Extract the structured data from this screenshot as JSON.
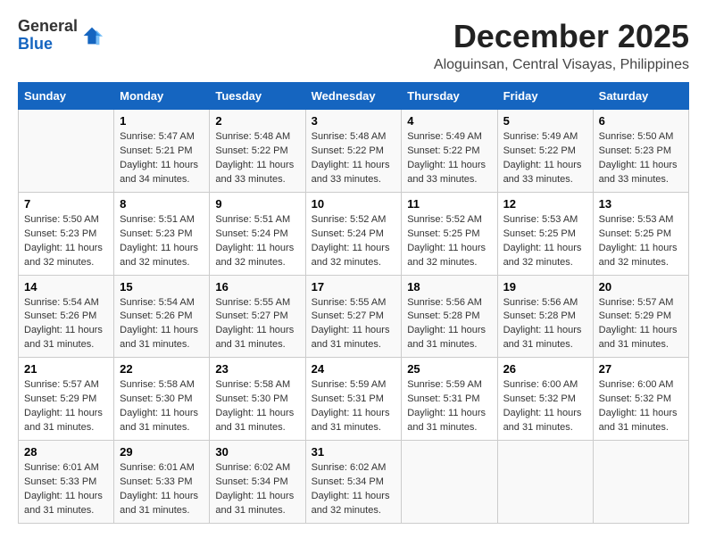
{
  "logo": {
    "general": "General",
    "blue": "Blue"
  },
  "header": {
    "title": "December 2025",
    "subtitle": "Aloguinsan, Central Visayas, Philippines"
  },
  "calendar": {
    "days_of_week": [
      "Sunday",
      "Monday",
      "Tuesday",
      "Wednesday",
      "Thursday",
      "Friday",
      "Saturday"
    ],
    "weeks": [
      [
        {
          "day": "",
          "info": ""
        },
        {
          "day": "1",
          "info": "Sunrise: 5:47 AM\nSunset: 5:21 PM\nDaylight: 11 hours\nand 34 minutes."
        },
        {
          "day": "2",
          "info": "Sunrise: 5:48 AM\nSunset: 5:22 PM\nDaylight: 11 hours\nand 33 minutes."
        },
        {
          "day": "3",
          "info": "Sunrise: 5:48 AM\nSunset: 5:22 PM\nDaylight: 11 hours\nand 33 minutes."
        },
        {
          "day": "4",
          "info": "Sunrise: 5:49 AM\nSunset: 5:22 PM\nDaylight: 11 hours\nand 33 minutes."
        },
        {
          "day": "5",
          "info": "Sunrise: 5:49 AM\nSunset: 5:22 PM\nDaylight: 11 hours\nand 33 minutes."
        },
        {
          "day": "6",
          "info": "Sunrise: 5:50 AM\nSunset: 5:23 PM\nDaylight: 11 hours\nand 33 minutes."
        }
      ],
      [
        {
          "day": "7",
          "info": "Sunrise: 5:50 AM\nSunset: 5:23 PM\nDaylight: 11 hours\nand 32 minutes."
        },
        {
          "day": "8",
          "info": "Sunrise: 5:51 AM\nSunset: 5:23 PM\nDaylight: 11 hours\nand 32 minutes."
        },
        {
          "day": "9",
          "info": "Sunrise: 5:51 AM\nSunset: 5:24 PM\nDaylight: 11 hours\nand 32 minutes."
        },
        {
          "day": "10",
          "info": "Sunrise: 5:52 AM\nSunset: 5:24 PM\nDaylight: 11 hours\nand 32 minutes."
        },
        {
          "day": "11",
          "info": "Sunrise: 5:52 AM\nSunset: 5:25 PM\nDaylight: 11 hours\nand 32 minutes."
        },
        {
          "day": "12",
          "info": "Sunrise: 5:53 AM\nSunset: 5:25 PM\nDaylight: 11 hours\nand 32 minutes."
        },
        {
          "day": "13",
          "info": "Sunrise: 5:53 AM\nSunset: 5:25 PM\nDaylight: 11 hours\nand 32 minutes."
        }
      ],
      [
        {
          "day": "14",
          "info": "Sunrise: 5:54 AM\nSunset: 5:26 PM\nDaylight: 11 hours\nand 31 minutes."
        },
        {
          "day": "15",
          "info": "Sunrise: 5:54 AM\nSunset: 5:26 PM\nDaylight: 11 hours\nand 31 minutes."
        },
        {
          "day": "16",
          "info": "Sunrise: 5:55 AM\nSunset: 5:27 PM\nDaylight: 11 hours\nand 31 minutes."
        },
        {
          "day": "17",
          "info": "Sunrise: 5:55 AM\nSunset: 5:27 PM\nDaylight: 11 hours\nand 31 minutes."
        },
        {
          "day": "18",
          "info": "Sunrise: 5:56 AM\nSunset: 5:28 PM\nDaylight: 11 hours\nand 31 minutes."
        },
        {
          "day": "19",
          "info": "Sunrise: 5:56 AM\nSunset: 5:28 PM\nDaylight: 11 hours\nand 31 minutes."
        },
        {
          "day": "20",
          "info": "Sunrise: 5:57 AM\nSunset: 5:29 PM\nDaylight: 11 hours\nand 31 minutes."
        }
      ],
      [
        {
          "day": "21",
          "info": "Sunrise: 5:57 AM\nSunset: 5:29 PM\nDaylight: 11 hours\nand 31 minutes."
        },
        {
          "day": "22",
          "info": "Sunrise: 5:58 AM\nSunset: 5:30 PM\nDaylight: 11 hours\nand 31 minutes."
        },
        {
          "day": "23",
          "info": "Sunrise: 5:58 AM\nSunset: 5:30 PM\nDaylight: 11 hours\nand 31 minutes."
        },
        {
          "day": "24",
          "info": "Sunrise: 5:59 AM\nSunset: 5:31 PM\nDaylight: 11 hours\nand 31 minutes."
        },
        {
          "day": "25",
          "info": "Sunrise: 5:59 AM\nSunset: 5:31 PM\nDaylight: 11 hours\nand 31 minutes."
        },
        {
          "day": "26",
          "info": "Sunrise: 6:00 AM\nSunset: 5:32 PM\nDaylight: 11 hours\nand 31 minutes."
        },
        {
          "day": "27",
          "info": "Sunrise: 6:00 AM\nSunset: 5:32 PM\nDaylight: 11 hours\nand 31 minutes."
        }
      ],
      [
        {
          "day": "28",
          "info": "Sunrise: 6:01 AM\nSunset: 5:33 PM\nDaylight: 11 hours\nand 31 minutes."
        },
        {
          "day": "29",
          "info": "Sunrise: 6:01 AM\nSunset: 5:33 PM\nDaylight: 11 hours\nand 31 minutes."
        },
        {
          "day": "30",
          "info": "Sunrise: 6:02 AM\nSunset: 5:34 PM\nDaylight: 11 hours\nand 31 minutes."
        },
        {
          "day": "31",
          "info": "Sunrise: 6:02 AM\nSunset: 5:34 PM\nDaylight: 11 hours\nand 32 minutes."
        },
        {
          "day": "",
          "info": ""
        },
        {
          "day": "",
          "info": ""
        },
        {
          "day": "",
          "info": ""
        }
      ]
    ]
  }
}
